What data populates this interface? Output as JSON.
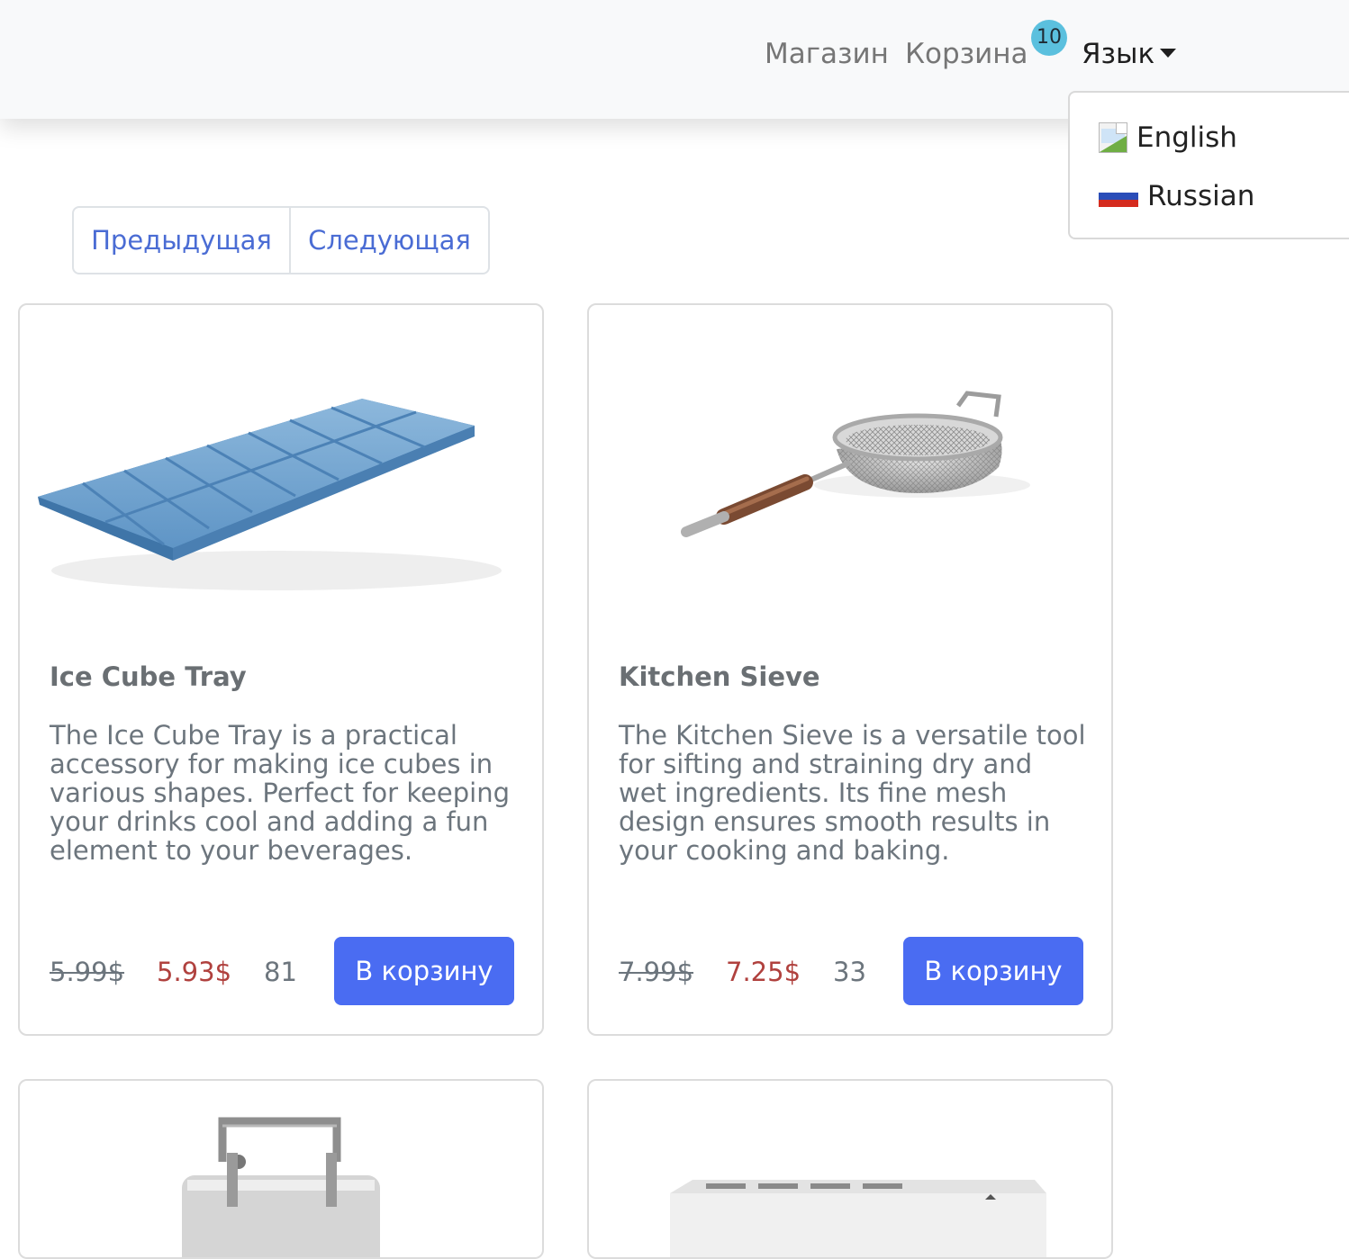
{
  "navbar": {
    "shop_label": "Магазин",
    "cart_label": "Корзина",
    "cart_count": "10",
    "language_label": "Язык"
  },
  "language_menu": {
    "items": [
      {
        "label": "English",
        "icon": "broken-image-icon"
      },
      {
        "label": "Russian",
        "icon": "russia-flag-icon"
      }
    ]
  },
  "pagination": {
    "prev_label": "Предыдущая",
    "next_label": "Следующая"
  },
  "products": [
    {
      "title": "Ice Cube Tray",
      "description": "The Ice Cube Tray is a practical accessory for making ice cubes in various shapes. Perfect for keeping your drinks cool and adding a fun element to your beverages.",
      "old_price": "5.99$",
      "new_price": "5.93$",
      "stock": "81",
      "button_label": "В корзину",
      "image": "ice-cube-tray-image"
    },
    {
      "title": "Kitchen Sieve",
      "description": "The Kitchen Sieve is a versatile tool for sifting and straining dry and wet ingredients. Its fine mesh design ensures smooth results in your cooking and baking.",
      "old_price": "7.99$",
      "new_price": "7.25$",
      "stock": "33",
      "button_label": "В корзину",
      "image": "kitchen-sieve-image"
    },
    {
      "image": "lunch-container-image"
    },
    {
      "image": "microwave-image"
    }
  ],
  "colors": {
    "accent": "#4a6cf2",
    "link": "#4a6cd4",
    "sale_price": "#b0413e",
    "badge": "#5bc0de",
    "navbar_bg": "#f8f9fa",
    "flag_white": "#ffffff",
    "flag_blue": "#2a4db8",
    "flag_red": "#d52b1e"
  }
}
